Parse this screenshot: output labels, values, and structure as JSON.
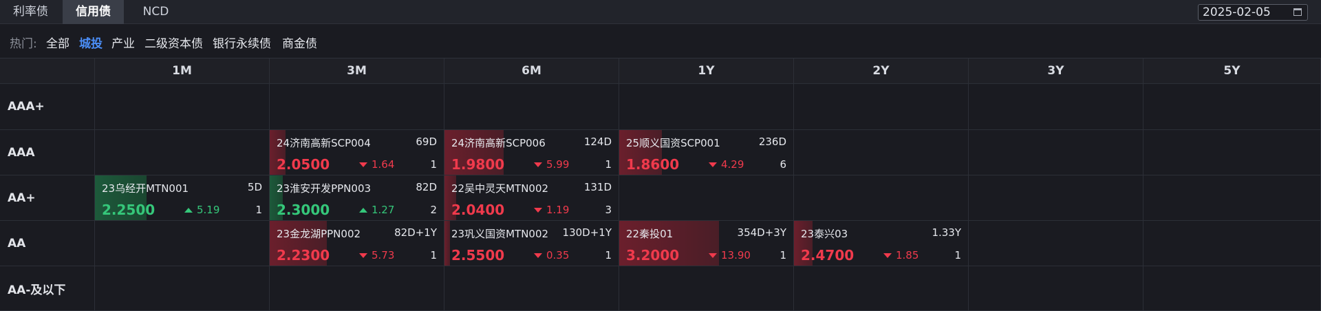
{
  "tabs": [
    {
      "label": "利率债",
      "active": false
    },
    {
      "label": "信用债",
      "active": true
    },
    {
      "label": "NCD",
      "active": false
    }
  ],
  "date_picker": {
    "value": "2025-02-05"
  },
  "hot": {
    "label": "热门:",
    "items": [
      {
        "label": "全部",
        "active": false
      },
      {
        "label": "城投",
        "active": true
      },
      {
        "label": "产业",
        "active": false
      },
      {
        "label": "二级资本债",
        "active": false
      },
      {
        "label": "银行永续债",
        "active": false
      },
      {
        "label": "商金债",
        "active": false
      }
    ]
  },
  "columns": [
    "1M",
    "3M",
    "6M",
    "1Y",
    "2Y",
    "3Y",
    "5Y"
  ],
  "rows": [
    "AAA+",
    "AAA",
    "AA+",
    "AA",
    "AA-及以下"
  ],
  "colors": {
    "down": "#f03a4c",
    "up": "#35c77a",
    "active_tab": "#3a3e48",
    "hot_active": "#4b8ef7"
  },
  "cells": [
    {
      "row": 1,
      "col": 1,
      "name": "24济南高新SCP004",
      "term": "69D",
      "yield": "2.0500",
      "change": "1.64",
      "direction": "down",
      "count": "1",
      "level": 0.16
    },
    {
      "row": 1,
      "col": 2,
      "name": "24济南高新SCP006",
      "term": "124D",
      "yield": "1.9800",
      "change": "5.99",
      "direction": "down",
      "count": "1",
      "level": 0.59
    },
    {
      "row": 1,
      "col": 3,
      "name": "25顺义国资SCP001",
      "term": "236D",
      "yield": "1.8600",
      "change": "4.29",
      "direction": "down",
      "count": "6",
      "level": 0.43
    },
    {
      "row": 2,
      "col": 0,
      "name": "23乌经开MTN001",
      "term": "5D",
      "yield": "2.2500",
      "change": "5.19",
      "direction": "up",
      "count": "1",
      "level": 0.52
    },
    {
      "row": 2,
      "col": 1,
      "name": "23淮安开发PPN003",
      "term": "82D",
      "yield": "2.3000",
      "change": "1.27",
      "direction": "up",
      "count": "2",
      "level": 0.13
    },
    {
      "row": 2,
      "col": 2,
      "name": "22吴中灵天MTN002",
      "term": "131D",
      "yield": "2.0400",
      "change": "1.19",
      "direction": "down",
      "count": "3",
      "level": 0.12
    },
    {
      "row": 3,
      "col": 1,
      "name": "23金龙湖PPN002",
      "term": "82D+1Y",
      "yield": "2.2300",
      "change": "5.73",
      "direction": "down",
      "count": "1",
      "level": 0.57
    },
    {
      "row": 3,
      "col": 2,
      "name": "23巩义国资MTN002",
      "term": "130D+1Y",
      "yield": "2.5500",
      "change": "0.35",
      "direction": "down",
      "count": "1",
      "level": 0.035
    },
    {
      "row": 3,
      "col": 3,
      "name": "22秦投01",
      "term": "354D+3Y",
      "yield": "3.2000",
      "change": "13.90",
      "direction": "down",
      "count": "1",
      "level": 1.0
    },
    {
      "row": 3,
      "col": 4,
      "name": "23泰兴03",
      "term": "1.33Y",
      "yield": "2.4700",
      "change": "1.85",
      "direction": "down",
      "count": "1",
      "level": 0.185
    }
  ]
}
